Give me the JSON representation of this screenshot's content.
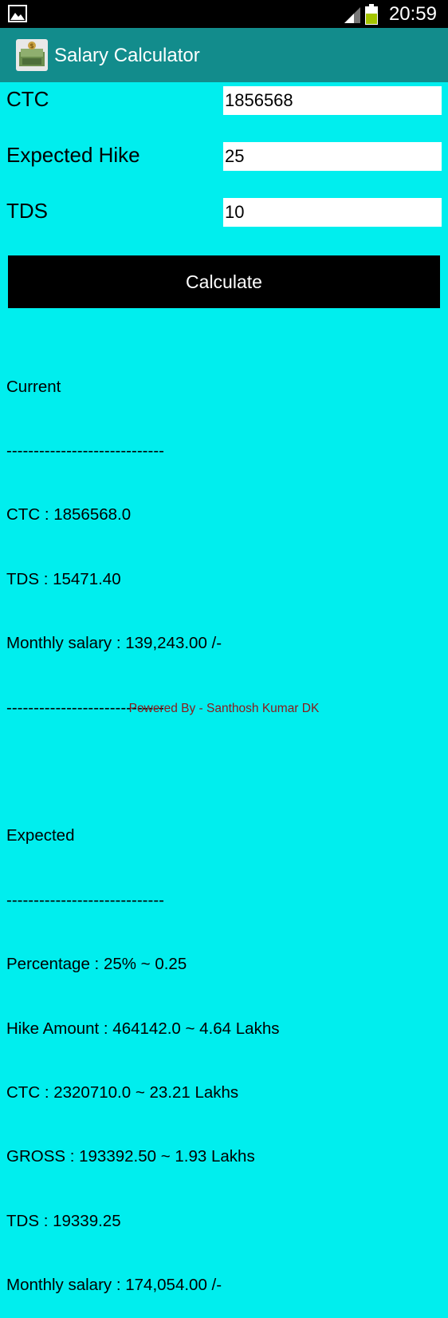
{
  "status_bar": {
    "time": "20:59",
    "left_icon": "image-icon",
    "signal_icon": "signal-icon",
    "battery_icon": "battery-icon",
    "battery_color": "#A4C400"
  },
  "action_bar": {
    "title": "Salary Calculator",
    "icon": "money-icon",
    "color": "#128C8C"
  },
  "form": {
    "ctc": {
      "label": "CTC",
      "value": "1856568"
    },
    "hike": {
      "label": "Expected Hike",
      "value": "25"
    },
    "tds": {
      "label": "TDS",
      "value": "10"
    }
  },
  "calculate_button": {
    "label": "Calculate"
  },
  "results": {
    "current": {
      "heading": "Current",
      "separator_top": "-----------------------------",
      "ctc": "CTC : 1856568.0",
      "tds": "TDS : 15471.40",
      "monthly": "Monthly salary : 139,243.00 /-",
      "separator_bottom": "-----------------------------"
    },
    "expected": {
      "heading": "Expected",
      "separator": "-----------------------------",
      "percentage": "Percentage : 25% ~ 0.25",
      "hike_amount": "Hike Amount : 464142.0 ~ 4.64 Lakhs",
      "ctc": "CTC : 2320710.0 ~ 23.21 Lakhs",
      "gross": "GROSS : 193392.50 ~ 1.93 Lakhs",
      "tds": "TDS : 19339.25",
      "monthly": "Monthly salary : 174,054.00 /-"
    }
  },
  "footer": {
    "text": "Powered By - Santhosh Kumar DK",
    "color": "#8B1A1A"
  },
  "background_color": "#00EEEE"
}
